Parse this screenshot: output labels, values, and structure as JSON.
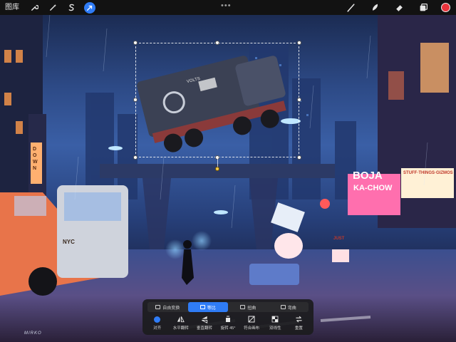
{
  "topbar": {
    "gallery_label": "图库",
    "left_tools": [
      "wrench-icon",
      "magic-wand-icon",
      "selection-s-icon",
      "transform-arrow-icon"
    ],
    "active_tool": "transform-arrow-icon",
    "right_tools": [
      "brush-icon",
      "smudge-icon",
      "eraser-icon",
      "layers-icon"
    ],
    "current_color": "#e8343c",
    "more_label": "•••"
  },
  "artwork": {
    "billboard_boja": "BOJA",
    "billboard_kachow": "KA-CHOW",
    "sign_stuff": "STUFF·THINGS·GIZMOS",
    "sign_down": "DOWN",
    "truck_text": "VOLTS",
    "taxi_text": "NYC",
    "sign_just": "JUST",
    "signature": "MIRKO"
  },
  "transform_panel": {
    "modes": [
      {
        "label": "自由变换",
        "active": false
      },
      {
        "label": "等比",
        "active": true
      },
      {
        "label": "扭曲",
        "active": false
      },
      {
        "label": "弯曲",
        "active": false
      }
    ],
    "actions": [
      {
        "label": "对齐",
        "icon": "snapping-icon"
      },
      {
        "label": "水平翻转",
        "icon": "flip-horizontal-icon"
      },
      {
        "label": "垂直翻转",
        "icon": "flip-vertical-icon"
      },
      {
        "label": "旋转 45°",
        "icon": "rotate-45-icon"
      },
      {
        "label": "符合画布",
        "icon": "fit-to-canvas-icon"
      },
      {
        "label": "双线性",
        "icon": "interpolation-icon"
      },
      {
        "label": "重置",
        "icon": "reset-icon"
      }
    ]
  },
  "colors": {
    "accent": "#2f7cf6",
    "toolbar_bg": "#121212",
    "selection_handle": "#ffffff",
    "rotation_handle": "#f2c94c"
  }
}
